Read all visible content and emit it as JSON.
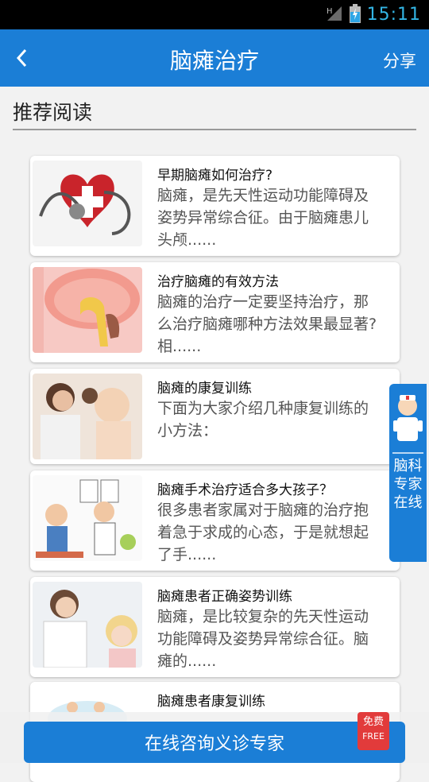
{
  "status": {
    "time": "15:11"
  },
  "header": {
    "title": "脑瘫治疗",
    "share": "分享"
  },
  "section": {
    "title": "推荐阅读"
  },
  "articles": [
    {
      "title": "早期脑瘫如何治疗?",
      "desc": "脑瘫，是先天性运动功能障碍及姿势异常综合征。由于脑瘫患儿头颅......"
    },
    {
      "title": "治疗脑瘫的有效方法",
      "desc": "脑瘫的治疗一定要坚持治疗，那么治疗脑瘫哪种方法效果最显著?相......"
    },
    {
      "title": "脑瘫的康复训练",
      "desc": "下面为大家介绍几种康复训练的小方法："
    },
    {
      "title": "脑瘫手术治疗适合多大孩子？",
      "desc": "很多患者家属对于脑瘫的治疗抱着急于求成的心态，于是就想起了手......"
    },
    {
      "title": "脑瘫患者正确姿势训练",
      "desc": "脑瘫，是比较复杂的先天性运动功能障碍及姿势异常综合征。脑瘫的......"
    },
    {
      "title": "脑瘫患者康复训练",
      "desc": ""
    }
  ],
  "floating": {
    "text": "脑科专家在线"
  },
  "bottom": {
    "button": "在线咨询义诊专家",
    "badge_cn": "免费",
    "badge_en": "FREE"
  }
}
